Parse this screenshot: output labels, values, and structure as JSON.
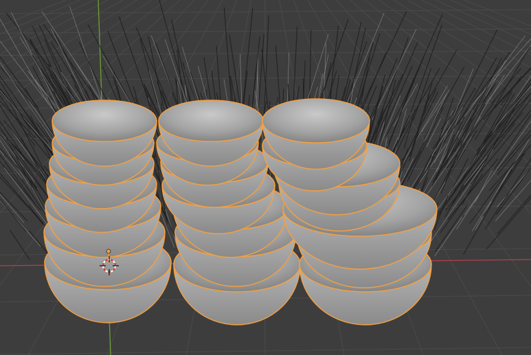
{
  "viewport": {
    "mode": "Object Mode",
    "background_color": "#3d3d3d",
    "grid_color": "#4a4a4a",
    "x_axis_color": "#b3404f",
    "y_axis_color": "#6fa035",
    "selection_outline_color": "#f5a040",
    "object_fill_color": "#a8a8a8",
    "particle_hair_color": "#1e1e1e",
    "selected_object_count": 3,
    "icons": [
      "3d-cursor-icon",
      "object-origin-icon"
    ]
  }
}
